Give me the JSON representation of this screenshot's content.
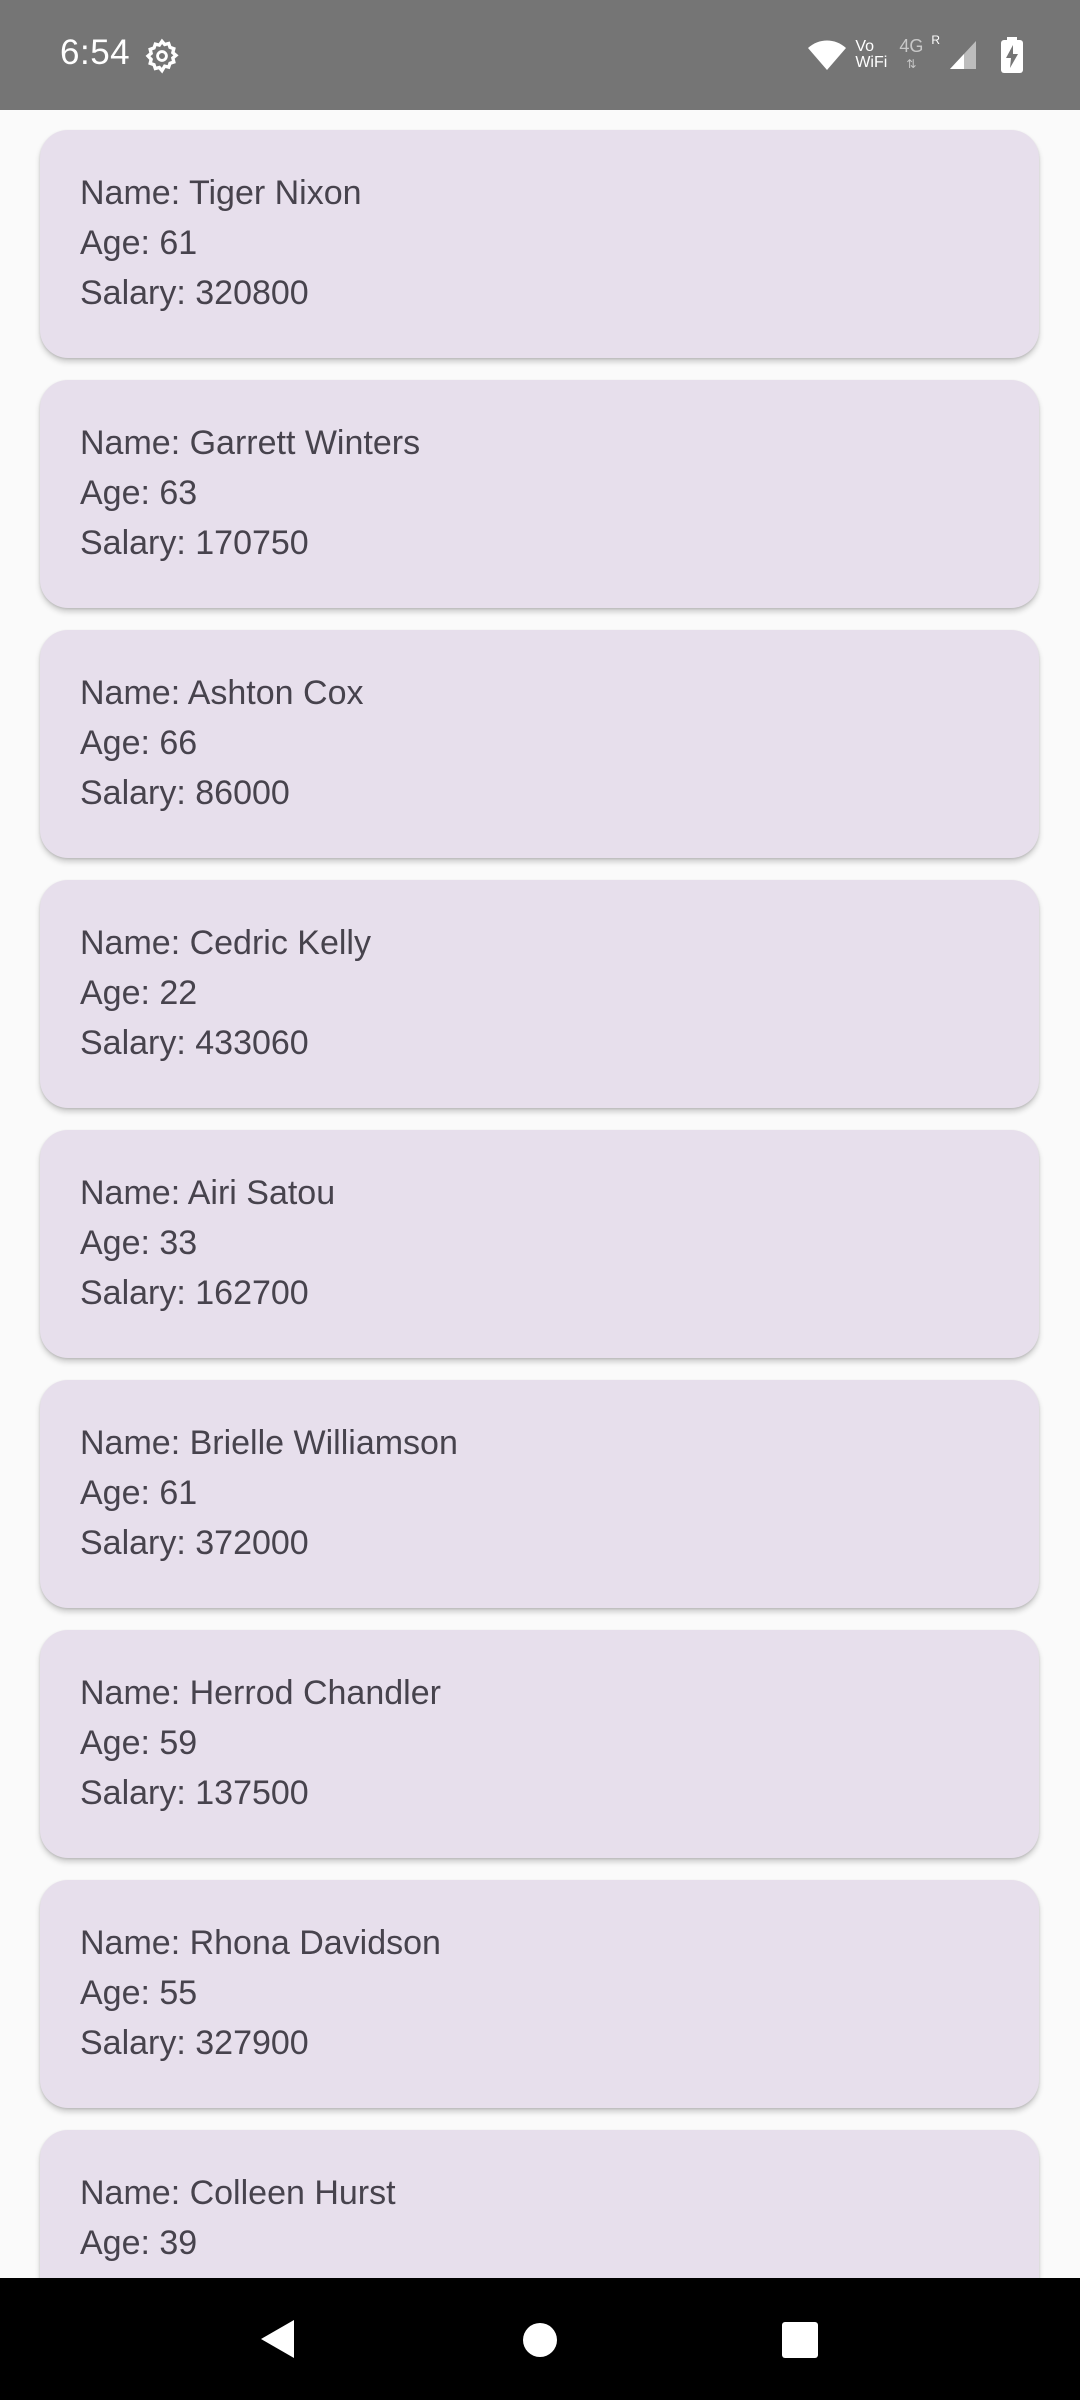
{
  "status_bar": {
    "time": "6:54",
    "vo_wifi_top": "Vo",
    "vo_wifi_bottom": "WiFi",
    "network": "4G",
    "roaming": "R",
    "icons": [
      "settings-gear-icon",
      "wifi-icon",
      "signal-icon",
      "battery-charging-icon"
    ]
  },
  "employees": [
    {
      "name": "Name: Tiger Nixon",
      "age": "Age: 61",
      "salary": "Salary: 320800"
    },
    {
      "name": "Name: Garrett Winters",
      "age": "Age: 63",
      "salary": "Salary: 170750"
    },
    {
      "name": "Name: Ashton Cox",
      "age": "Age: 66",
      "salary": "Salary: 86000"
    },
    {
      "name": "Name: Cedric Kelly",
      "age": "Age: 22",
      "salary": "Salary: 433060"
    },
    {
      "name": "Name: Airi Satou",
      "age": "Age: 33",
      "salary": "Salary: 162700"
    },
    {
      "name": "Name: Brielle Williamson",
      "age": "Age: 61",
      "salary": "Salary: 372000"
    },
    {
      "name": "Name: Herrod Chandler",
      "age": "Age: 59",
      "salary": "Salary: 137500"
    },
    {
      "name": "Name: Rhona Davidson",
      "age": "Age: 55",
      "salary": "Salary: 327900"
    },
    {
      "name": "Name: Colleen Hurst",
      "age": "Age: 39",
      "salary": ""
    }
  ],
  "nav_bar": {
    "icons": [
      "back-icon",
      "home-icon",
      "recents-icon"
    ]
  },
  "colors": {
    "status_bar": "#757575",
    "card_background": "#e7dfec",
    "card_text": "#47434d",
    "page_background": "#fafafa",
    "nav_bar": "#000000"
  }
}
